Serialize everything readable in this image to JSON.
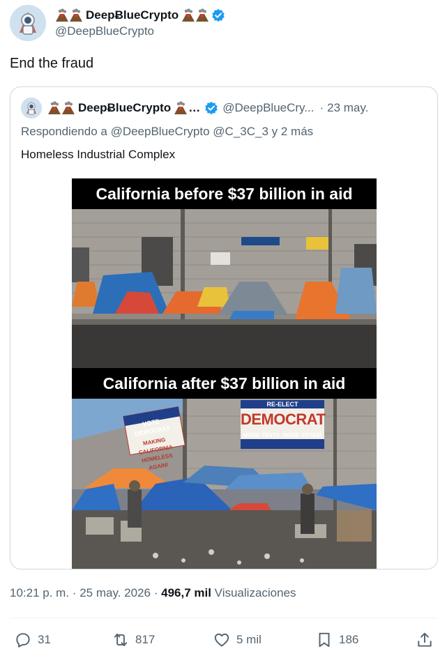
{
  "author": {
    "display_name": "DeepɃlueCrypto",
    "handle": "@DeepBlueCrypto"
  },
  "tweet": {
    "text": "End the fraud"
  },
  "quoted": {
    "display_name": "DeepɃlueCrypto",
    "name_ellipsis": "…",
    "handle": "@DeepBlueCry...",
    "dot": "·",
    "date": "23 may.",
    "reply_prefix": "Respondiendo a",
    "reply_mentions": "@DeepBlueCrypto @C_3C_3 y 2 más",
    "text": "Homeless Industrial Complex",
    "media": {
      "caption_top": "California before $37 billion in aid",
      "caption_bottom": "California after $37 billion in aid",
      "sign_left_1": "VOTE DEMOCRAT",
      "sign_left_2": "MAKING CALIFORNIA",
      "sign_left_3": "HOMELESS AGAIN!",
      "sign_right_1": "RE-ELECT",
      "sign_right_2": "DEMOCRAT",
      "sign_right_3": "MORE TENTS, MORE VOTES!"
    }
  },
  "meta": {
    "time": "10:21 p. m.",
    "dot1": "·",
    "date": "25 may. 2026",
    "dot2": "·",
    "views": "496,7 mil",
    "views_label": "Visualizaciones"
  },
  "actions": {
    "replies": "31",
    "reposts": "817",
    "likes": "5 mil",
    "bookmarks": "186"
  },
  "colors": {
    "verified": "#1d9bf0",
    "muted": "#536471",
    "text": "#0f1419"
  },
  "icons": [
    "volcano-icon",
    "verified-badge-icon",
    "reply-icon",
    "repost-icon",
    "like-icon",
    "bookmark-icon",
    "share-icon"
  ]
}
